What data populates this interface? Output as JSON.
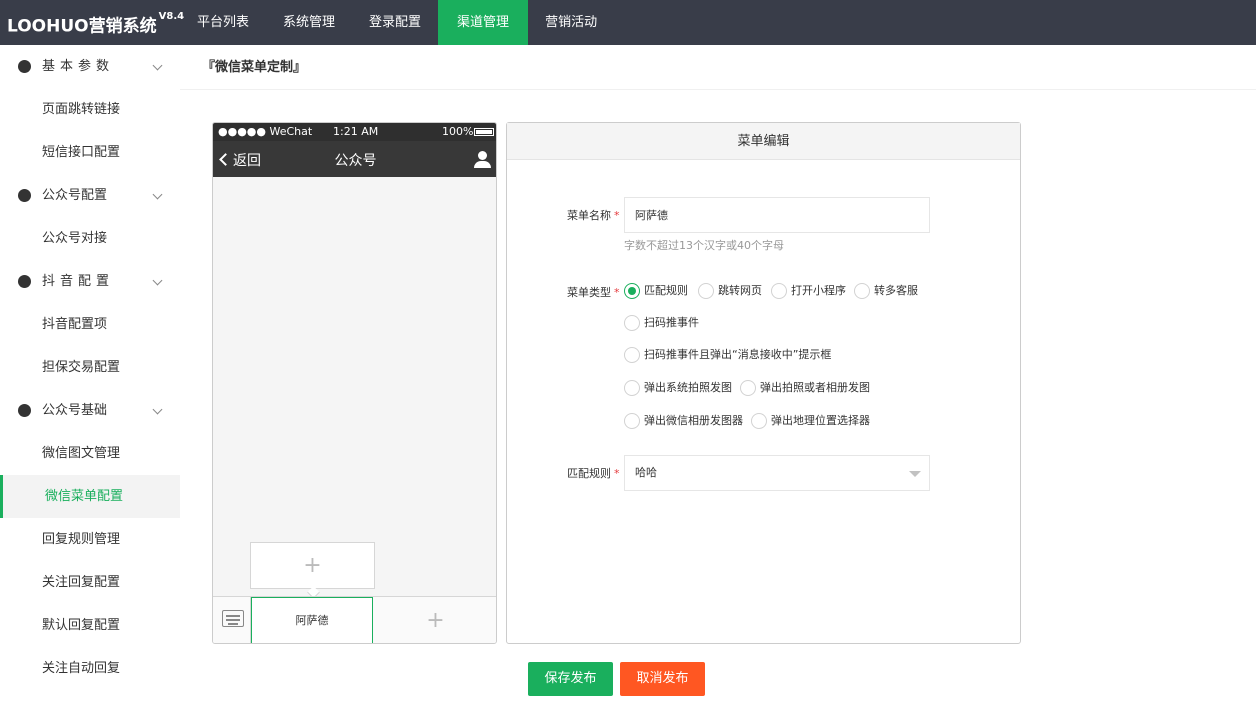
{
  "app": {
    "title": "LOOHUO营销系统",
    "version": "V8.4"
  },
  "topnav": [
    {
      "label": "平台列表",
      "active": false
    },
    {
      "label": "系统管理",
      "active": false
    },
    {
      "label": "登录配置",
      "active": false
    },
    {
      "label": "渠道管理",
      "active": true
    },
    {
      "label": "营销活动",
      "active": false
    }
  ],
  "colors": {
    "accent": "#1aaf5d",
    "danger": "#ff5722",
    "topbar": "#393d49"
  },
  "sidebar": {
    "groups": [
      {
        "label": "基本参数",
        "icon": "compass-icon",
        "items": [
          "页面跳转链接",
          "短信接口配置"
        ]
      },
      {
        "label": "公众号配置",
        "icon": "wechat-icon",
        "items": [
          "公众号对接"
        ]
      },
      {
        "label": "抖音配置",
        "icon": "play-icon",
        "items": [
          "抖音配置项",
          "担保交易配置"
        ]
      },
      {
        "label": "公众号基础",
        "icon": "location-icon",
        "items": [
          "微信图文管理",
          "微信菜单配置",
          "回复规则管理",
          "关注回复配置",
          "默认回复配置",
          "关注自动回复"
        ]
      }
    ],
    "active_item": "微信菜单配置"
  },
  "breadcrumb": "『微信菜单定制』",
  "phone": {
    "carrier": "●●●●● WeChat",
    "time": "1:21 AM",
    "battery": "100%",
    "back_label": "返回",
    "title": "公众号",
    "menu_main": "阿萨德",
    "add_symbol": "+"
  },
  "editor": {
    "header": "菜单编辑",
    "name_label": "菜单名称",
    "name_value": "阿萨德",
    "name_hint": "字数不超过13个汉字或40个字母",
    "type_label": "菜单类型",
    "type_options": [
      {
        "label": "匹配规则",
        "checked": true
      },
      {
        "label": "跳转网页",
        "checked": false
      },
      {
        "label": "打开小程序",
        "checked": false
      },
      {
        "label": "转多客服",
        "checked": false
      },
      {
        "label": "扫码推事件",
        "checked": false
      },
      {
        "label": "扫码推事件且弹出“消息接收中”提示框",
        "checked": false
      },
      {
        "label": "弹出系统拍照发图",
        "checked": false
      },
      {
        "label": "弹出拍照或者相册发图",
        "checked": false
      },
      {
        "label": "弹出微信相册发图器",
        "checked": false
      },
      {
        "label": "弹出地理位置选择器",
        "checked": false
      }
    ],
    "rule_label": "匹配规则",
    "rule_value": "哈哈",
    "required_mark": "*"
  },
  "buttons": {
    "save": "保存发布",
    "cancel": "取消发布"
  }
}
